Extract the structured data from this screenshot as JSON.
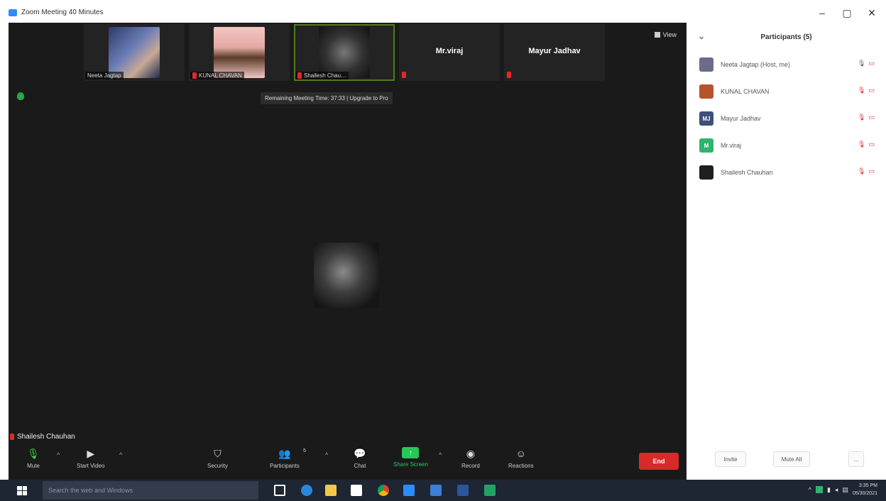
{
  "window": {
    "title": "Zoom Meeting 40 Minutes",
    "controls": {
      "minimize": "–",
      "maximize": "▢",
      "close": "✕"
    }
  },
  "meeting": {
    "view_label": "View",
    "timer_banner": "Remaining Meeting Time: 37:33 | Upgrade to Pro",
    "active_speaker": "Shailesh Chauhan",
    "thumbnails": [
      {
        "name": "Neeta Jagtap",
        "type": "video"
      },
      {
        "name": "KUNAL CHAVAN",
        "type": "video"
      },
      {
        "name": "Shailesh Chau…",
        "type": "video"
      },
      {
        "name": "Mr.viraj",
        "type": "name"
      },
      {
        "name": "Mayur Jadhav",
        "type": "name"
      }
    ]
  },
  "toolbar": {
    "mute": "Mute",
    "start_video": "Start Video",
    "security": "Security",
    "participants": "Participants",
    "participants_count": "5",
    "chat": "Chat",
    "share_screen": "Share Screen",
    "record": "Record",
    "reactions": "Reactions",
    "end": "End"
  },
  "participants_panel": {
    "title": "Participants (5)",
    "items": [
      {
        "name": "Neeta Jagtap (Host, me)",
        "avatar_color": "#6b6b8a",
        "initials": ""
      },
      {
        "name": "KUNAL CHAVAN",
        "avatar_color": "#b5532e",
        "initials": ""
      },
      {
        "name": "Mayur Jadhav",
        "avatar_color": "#3d4f7a",
        "initials": "MJ"
      },
      {
        "name": "Mr.viraj",
        "avatar_color": "#2fb36f",
        "initials": "M"
      },
      {
        "name": "Shailesh Chauhan",
        "avatar_color": "#1e1e1e",
        "initials": ""
      }
    ],
    "invite": "Invite",
    "mute_all": "Mute All",
    "more": "..."
  },
  "taskbar": {
    "search_placeholder": "Search the web and Windows",
    "time": "3:35 PM",
    "date": "05/30/2021"
  }
}
